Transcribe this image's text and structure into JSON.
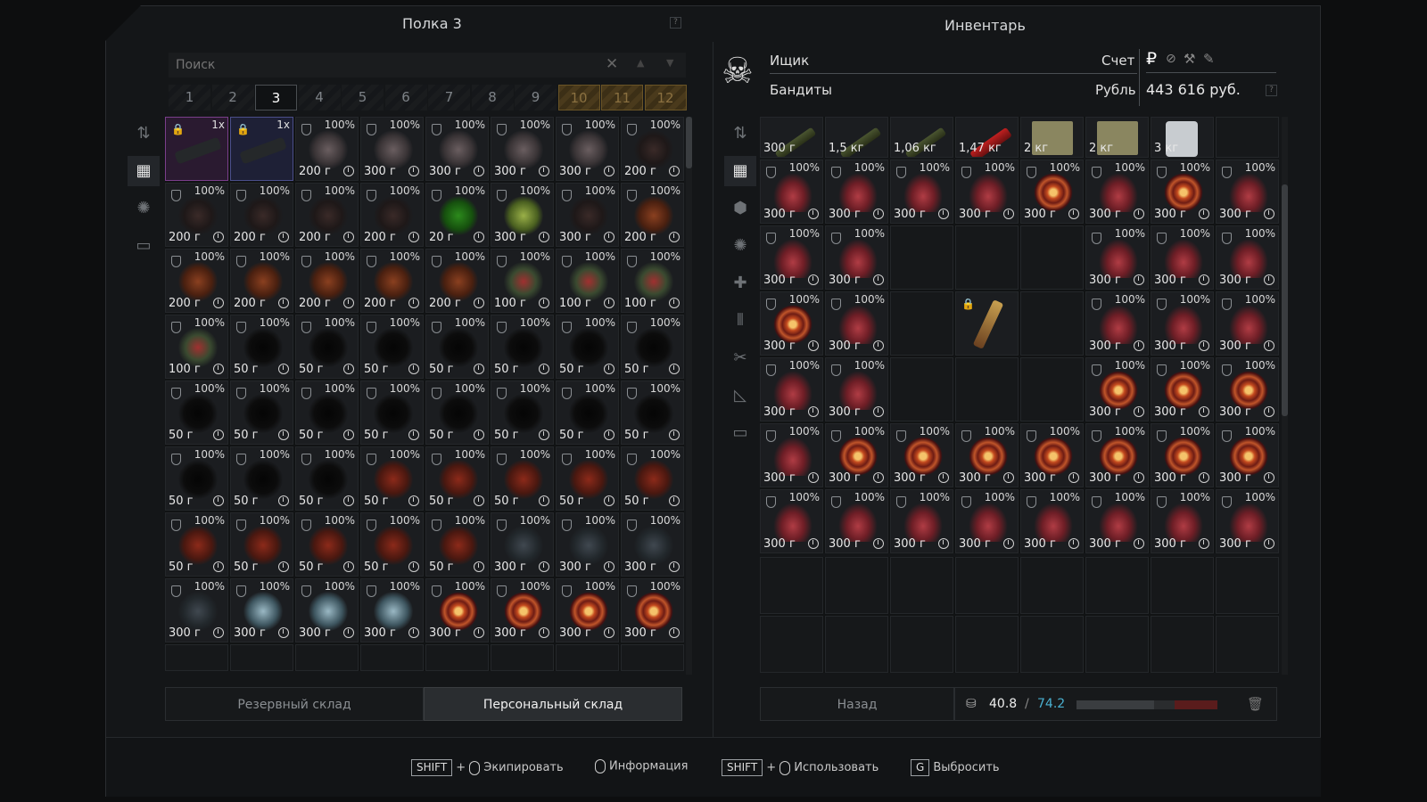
{
  "left": {
    "title": "Полка 3",
    "help": "?",
    "search_placeholder": "Поиск",
    "tabs": [
      "1",
      "2",
      "3",
      "4",
      "5",
      "6",
      "7",
      "8",
      "9",
      "10",
      "11",
      "12"
    ],
    "active_tab": "3",
    "bottom_tabs": [
      "Резервный склад",
      "Персональный склад"
    ],
    "side_icons": [
      "sort-icon",
      "grid-icon",
      "artifact-icon",
      "archive-icon"
    ]
  },
  "right": {
    "title": "Инвентарь",
    "owner_label": "Ищик",
    "faction": "Бандиты",
    "account_label": "Счет",
    "currency_label": "Рубль",
    "balance": "443 616 руб.",
    "currency_icons": [
      "ruble-icon",
      "coin-icon",
      "tool-icon",
      "ticket-icon"
    ],
    "help": "?",
    "back_label": "Назад",
    "weight_current": "40.8",
    "weight_sep": "/",
    "weight_max": "74.2",
    "weight_fraction": 0.55,
    "side_icons": [
      "sort-icon",
      "grid-icon",
      "ammo-icon",
      "artifact-icon",
      "medkit-icon",
      "bullets-icon",
      "tools-icon",
      "ruler-icon",
      "archive-icon"
    ]
  },
  "footer": {
    "hints": [
      {
        "key": "SHIFT",
        "plus": "+",
        "label": "Экипировать"
      },
      {
        "key": "",
        "plus": "",
        "label": "Информация"
      },
      {
        "key": "SHIFT",
        "plus": "+",
        "label": "Использовать"
      },
      {
        "key": "G",
        "plus": "",
        "label": "Выбросить"
      }
    ]
  },
  "stash_items": [
    [
      "gun:1x:pink",
      "gun:1x:blue",
      "gray:200 г",
      "gray:300 г",
      "gray:300 г",
      "gray:300 г",
      "gray:300 г",
      "dark:200 г"
    ],
    [
      "dark:200 г",
      "dark:200 г",
      "dark:200 г",
      "dark:200 г",
      "green:20 г",
      "lime:300 г",
      "dark:300 г",
      "brown:200 г"
    ],
    [
      "brown:200 г",
      "brown:200 г",
      "brown:200 г",
      "brown:200 г",
      "brown:200 г",
      "flower:100 г",
      "flower:100 г",
      "flower:100 г"
    ],
    [
      "flower:100 г",
      "black:50 г",
      "black:50 г",
      "black:50 г",
      "black:50 г",
      "black:50 г",
      "black:50 г",
      "black:50 г"
    ],
    [
      "black:50 г",
      "black:50 г",
      "black:50 г",
      "black:50 г",
      "black:50 г",
      "black:50 г",
      "black:50 г",
      "black:50 г"
    ],
    [
      "black:50 г",
      "black:50 г",
      "black:50 г",
      "rbrown:50 г",
      "rbrown:50 г",
      "rbrown:50 г",
      "rbrown:50 г",
      "rbrown:50 г"
    ],
    [
      "rbrown:50 г",
      "rbrown:50 г",
      "rbrown:50 г",
      "rbrown:50 г",
      "rbrown:50 г",
      "slate:300 г",
      "slate:300 г",
      "slate:300 г"
    ],
    [
      "slate:300 г",
      "ice:300 г",
      "ice:300 г",
      "ice:300 г",
      "swirl:300 г",
      "swirl:300 г",
      "swirl:300 г",
      "swirl:300 г"
    ]
  ],
  "inv_top": [
    {
      "art": "tube",
      "w": "300 г"
    },
    {
      "art": "tube",
      "w": "1,5 кг"
    },
    {
      "art": "tube",
      "w": "1,06 кг"
    },
    {
      "art": "rtube",
      "w": "1,47 кг"
    },
    {
      "art": "box",
      "w": "2 кг"
    },
    {
      "art": "box",
      "w": "2 кг"
    },
    {
      "art": "white",
      "w": "3 кг"
    },
    {
      "art": "",
      "w": ""
    }
  ],
  "inv_items": [
    [
      "red",
      "red",
      "red",
      "red",
      "swirl",
      "red",
      "swirl",
      "red"
    ],
    [
      "red",
      "red",
      "",
      "",
      "",
      "red",
      "red",
      "red"
    ],
    [
      "swirl",
      "red",
      "",
      "broom",
      "",
      "red",
      "red",
      "red"
    ],
    [
      "red",
      "red",
      "",
      "",
      "",
      "swirl",
      "swirl",
      "swirl"
    ],
    [
      "red",
      "swirl",
      "swirl",
      "swirl",
      "swirl",
      "swirl",
      "swirl",
      "swirl"
    ],
    [
      "red",
      "red",
      "red",
      "red",
      "red",
      "red",
      "red",
      "red"
    ]
  ],
  "pct": "100%",
  "artifact_weight": "300 г"
}
